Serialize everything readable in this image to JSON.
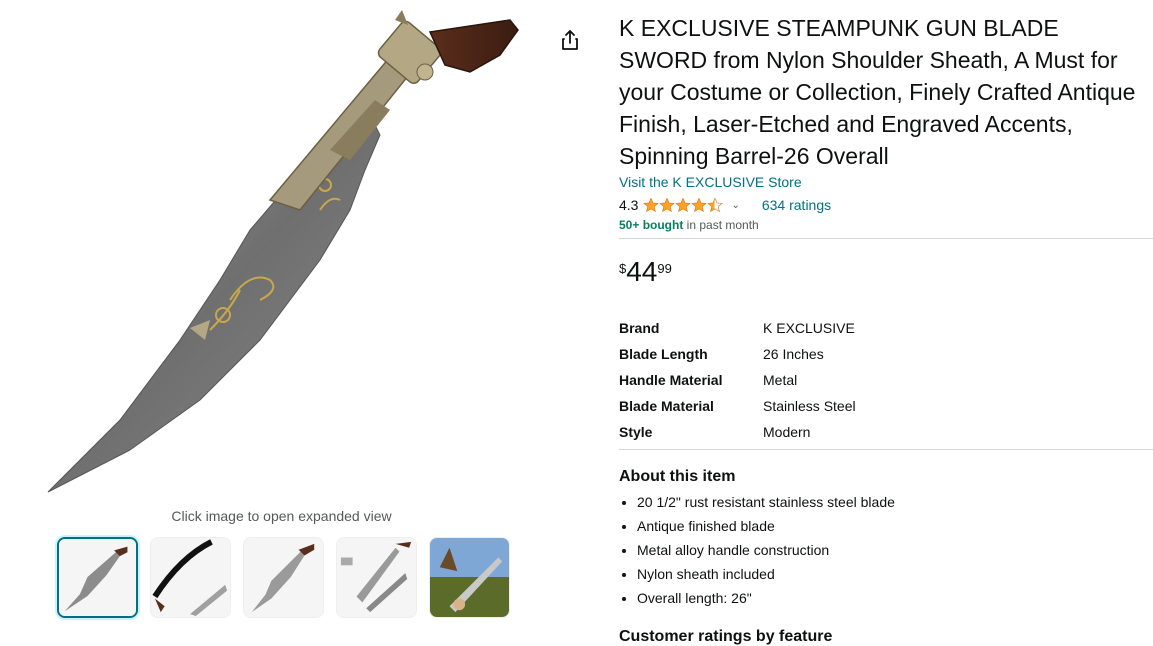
{
  "gallery": {
    "click_hint": "Click image to open expanded view",
    "share_icon": "share-icon",
    "thumbnails": [
      {
        "name": "thumbnail-1",
        "active": true
      },
      {
        "name": "thumbnail-2",
        "active": false
      },
      {
        "name": "thumbnail-3",
        "active": false
      },
      {
        "name": "thumbnail-4",
        "active": false
      },
      {
        "name": "thumbnail-5",
        "active": false
      }
    ]
  },
  "product": {
    "title": "K EXCLUSIVE STEAMPUNK GUN BLADE SWORD from Nylon Shoulder Sheath, A Must for your Costume or Collection, Finely Crafted Antique Finish, Laser-Etched and Engraved Accents, Spinning Barrel-26 Overall",
    "store_link": "Visit the K EXCLUSIVE Store",
    "rating": "4.3",
    "rating_fraction": 0.86,
    "ratings_count": "634 ratings",
    "bought_bold": "50+ bought",
    "bought_rest": " in past month",
    "price": {
      "symbol": "$",
      "whole": "44",
      "fraction": "99"
    }
  },
  "specs": [
    {
      "key": "Brand",
      "value": "K EXCLUSIVE"
    },
    {
      "key": "Blade Length",
      "value": "26 Inches"
    },
    {
      "key": "Handle Material",
      "value": "Metal"
    },
    {
      "key": "Blade Material",
      "value": "Stainless Steel"
    },
    {
      "key": "Style",
      "value": "Modern"
    }
  ],
  "about": {
    "heading": "About this item",
    "bullets": [
      "20 1/2\" rust resistant stainless steel blade",
      "Antique finished blade",
      "Metal alloy handle construction",
      "Nylon sheath included",
      "Overall length: 26\""
    ]
  },
  "customer_ratings_heading": "Customer ratings by feature",
  "colors": {
    "link": "#007185",
    "star": "#ffa41c",
    "bought": "#067d62",
    "accent": "#007185"
  }
}
